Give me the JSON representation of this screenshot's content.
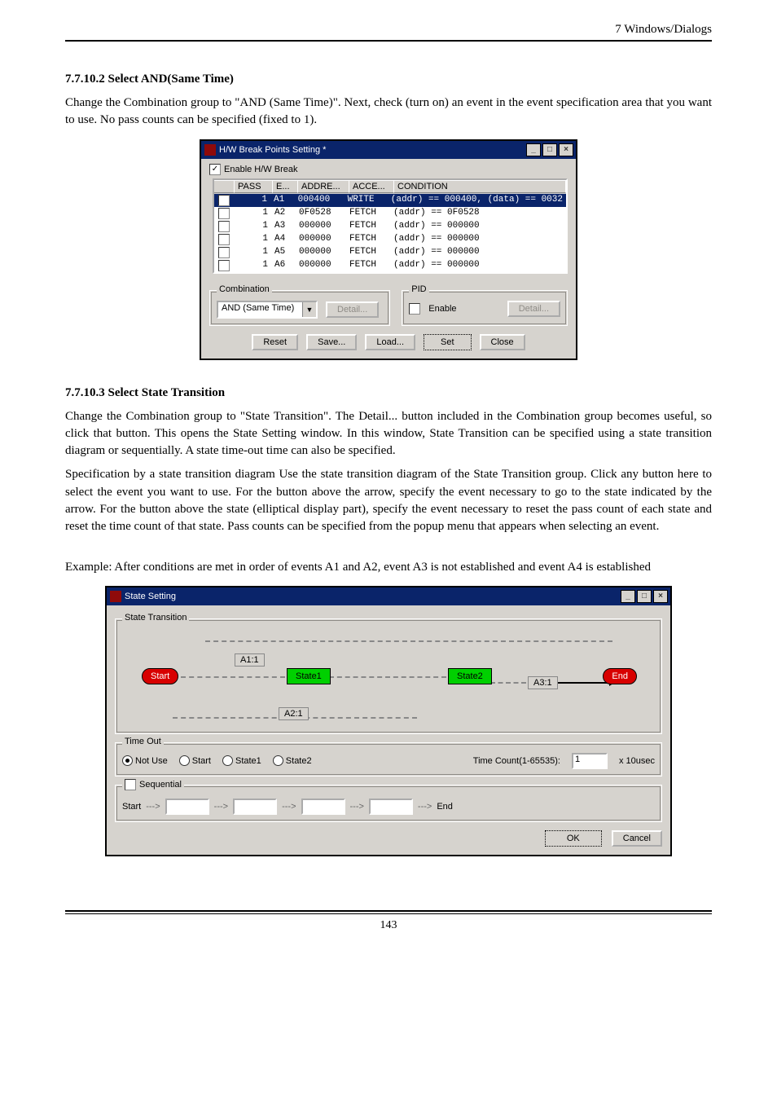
{
  "header": {
    "title": "7  Windows/Dialogs"
  },
  "section1": {
    "title": "7.7.10.2 Select AND(Same Time)",
    "para": "Change the Combination group to \"AND (Same Time)\". Next, check (turn on) an event in the event specification area that you want to use. No pass counts can be specified (fixed to 1)."
  },
  "dialog1": {
    "title": "H/W Break Points Setting *",
    "enable_label": "Enable H/W Break",
    "columns": {
      "pass": "PASS",
      "e": "E...",
      "addre": "ADDRE...",
      "acce": "ACCE...",
      "condition": "CONDITION"
    },
    "rows": [
      {
        "checked": true,
        "pass": "1",
        "e": "A1",
        "addr": "000400",
        "acce": "WRITE",
        "cond": "(addr) == 000400, (data) == 0032",
        "selected": true
      },
      {
        "checked": false,
        "pass": "1",
        "e": "A2",
        "addr": "0F0528",
        "acce": "FETCH",
        "cond": "(addr) == 0F0528"
      },
      {
        "checked": false,
        "pass": "1",
        "e": "A3",
        "addr": "000000",
        "acce": "FETCH",
        "cond": "(addr) == 000000"
      },
      {
        "checked": false,
        "pass": "1",
        "e": "A4",
        "addr": "000000",
        "acce": "FETCH",
        "cond": "(addr) == 000000"
      },
      {
        "checked": false,
        "pass": "1",
        "e": "A5",
        "addr": "000000",
        "acce": "FETCH",
        "cond": "(addr) == 000000"
      },
      {
        "checked": false,
        "pass": "1",
        "e": "A6",
        "addr": "000000",
        "acce": "FETCH",
        "cond": "(addr) == 000000"
      }
    ],
    "combination": {
      "title": "Combination",
      "mode": "AND (Same Time)",
      "detail": "Detail..."
    },
    "pid": {
      "title": "PID",
      "enable": "Enable",
      "detail": "Detail..."
    },
    "buttons": {
      "reset": "Reset",
      "save": "Save...",
      "load": "Load...",
      "set": "Set",
      "close": "Close"
    }
  },
  "section2": {
    "title": "7.7.10.3 Select State Transition",
    "para1": "Change the Combination group to \"State Transition\". The Detail... button included in the Combination group becomes useful, so click that button. This opens the State Setting window. In this window, State Transition can be specified using a state transition diagram or sequentially. A state time-out time can also be specified.",
    "para2": "Specification by a state transition diagram Use the state transition diagram of the State Transition group. Click any button here to select the event you want to use. For the button above the arrow, specify the event necessary to go to the state indicated by the arrow. For the button above the state (elliptical display part), specify the event necessary to reset the pass count of each state and reset the time count of that state. Pass counts can be specified from the popup menu that appears when selecting an event.",
    "para3": "Example: After conditions are met in order of events A1 and A2, event A3 is not established and event A4 is established"
  },
  "dialog2": {
    "title": "State Setting",
    "group_state": "State Transition",
    "nodes": {
      "start": "Start",
      "state1": "State1",
      "state2": "State2",
      "end": "End"
    },
    "chips": {
      "a1": "A1:1",
      "a2": "A2:1",
      "a3": "A3:1"
    },
    "timeout": {
      "title": "Time Out",
      "options": {
        "notuse": "Not Use",
        "start": "Start",
        "state1": "State1",
        "state2": "State2"
      },
      "count_label": "Time Count(1-65535):",
      "count_value": "1",
      "unit": "x 10usec"
    },
    "sequential": {
      "title": "Sequential",
      "start": "Start",
      "end": "End",
      "arrow": "--->"
    },
    "buttons": {
      "ok": "OK",
      "cancel": "Cancel"
    }
  },
  "page_number": "143"
}
